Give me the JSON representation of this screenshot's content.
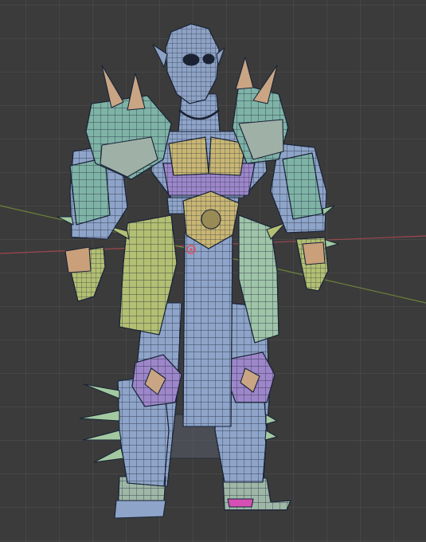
{
  "viewport": {
    "background": "#3b3b3b",
    "grid_color": "#4a4a4a",
    "axis_x_color": "#b84a56",
    "axis_y_color": "#7d9a3a",
    "origin_color": "#e0505a"
  },
  "model": {
    "wire_color": "#1a2438",
    "materials": {
      "skin": "#8ea2c4",
      "armor_teal": "#7fb3a6",
      "armor_blue": "#8ea4c8",
      "gold": "#c9b673",
      "olive": "#b3bf72",
      "purple": "#9d86c9",
      "spike_tan": "#c9a584",
      "spike_green": "#a2c9a0",
      "hand_tan": "#c9a07a",
      "boot_magenta": "#d64fb4"
    }
  }
}
